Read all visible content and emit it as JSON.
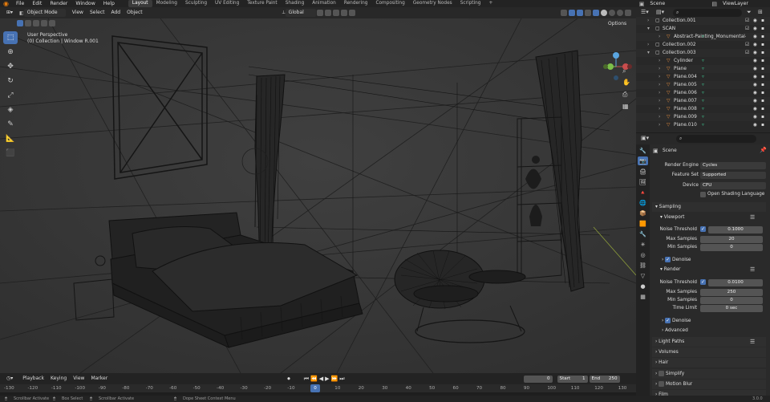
{
  "topbar": {
    "menus": [
      "File",
      "Edit",
      "Render",
      "Window",
      "Help"
    ],
    "workspaces": [
      "Layout",
      "Modeling",
      "Sculpting",
      "UV Editing",
      "Texture Paint",
      "Shading",
      "Animation",
      "Rendering",
      "Compositing",
      "Geometry Nodes",
      "Scripting"
    ],
    "active_workspace": "Layout",
    "add_tab": "+",
    "scene": "Scene",
    "view_layer": "ViewLayer"
  },
  "viewport_header": {
    "mode": "Object Mode",
    "menus": [
      "View",
      "Select",
      "Add",
      "Object"
    ],
    "transform": "Global",
    "options": "Options"
  },
  "viewport": {
    "perspective": "User Perspective",
    "collection_info": "(0) Collection | Window R.001"
  },
  "outliner": {
    "items": [
      {
        "label": "Collection.001",
        "indent": 1,
        "type": "collection"
      },
      {
        "label": "SCAN",
        "indent": 1,
        "type": "collection"
      },
      {
        "label": "Abstract-Painting_Monumental-F",
        "indent": 2,
        "type": "mesh"
      },
      {
        "label": "Collection.002",
        "indent": 1,
        "type": "collection"
      },
      {
        "label": "Collection.003",
        "indent": 1,
        "type": "collection"
      },
      {
        "label": "Cylinder",
        "indent": 2,
        "type": "mesh"
      },
      {
        "label": "Plane",
        "indent": 2,
        "type": "mesh"
      },
      {
        "label": "Plane.004",
        "indent": 2,
        "type": "mesh"
      },
      {
        "label": "Plane.005",
        "indent": 2,
        "type": "mesh"
      },
      {
        "label": "Plane.006",
        "indent": 2,
        "type": "mesh"
      },
      {
        "label": "Plane.007",
        "indent": 2,
        "type": "mesh"
      },
      {
        "label": "Plane.008",
        "indent": 2,
        "type": "mesh"
      },
      {
        "label": "Plane.009",
        "indent": 2,
        "type": "mesh"
      },
      {
        "label": "Plane.010",
        "indent": 2,
        "type": "mesh"
      }
    ]
  },
  "properties": {
    "scene_label": "Scene",
    "render_engine_label": "Render Engine",
    "render_engine": "Cycles",
    "feature_set_label": "Feature Set",
    "feature_set": "Supported",
    "device_label": "Device",
    "device": "CPU",
    "osl_label": "Open Shading Language",
    "sampling": "Sampling",
    "viewport": "Viewport",
    "vp_noise_label": "Noise Threshold",
    "vp_noise": "0.1000",
    "vp_max_label": "Max Samples",
    "vp_max": "20",
    "vp_min_label": "Min Samples",
    "vp_min": "0",
    "vp_denoise": "Denoise",
    "render": "Render",
    "r_noise_label": "Noise Threshold",
    "r_noise": "0.0100",
    "r_max_label": "Max Samples",
    "r_max": "250",
    "r_min_label": "Min Samples",
    "r_min": "0",
    "r_time_label": "Time Limit",
    "r_time": "0 sec",
    "r_denoise": "Denoise",
    "advanced": "Advanced",
    "light_paths": "Light Paths",
    "volumes": "Volumes",
    "hair": "Hair",
    "simplify": "Simplify",
    "motion_blur": "Motion Blur",
    "film": "Film"
  },
  "timeline": {
    "menus": [
      "Playback",
      "Keying",
      "View",
      "Marker"
    ],
    "current_frame": "0",
    "start_label": "Start",
    "start": "1",
    "end_label": "End",
    "end": "250",
    "ruler": [
      "-130",
      "-120",
      "-110",
      "-100",
      "-90",
      "-80",
      "-70",
      "-60",
      "-50",
      "-40",
      "-30",
      "-20",
      "-10",
      "0",
      "10",
      "20",
      "30",
      "40",
      "50",
      "60",
      "70",
      "80",
      "90",
      "100",
      "110",
      "120",
      "130"
    ],
    "playhead": "0"
  },
  "statusbar": {
    "items": [
      "Scrollbar Activate",
      "Box Select",
      "Scrollbar Activate",
      "Dope Sheet Context Menu"
    ],
    "version": "3.0.0"
  },
  "colors": {
    "accent": "#4772b3",
    "bg": "#1d1d1d",
    "panel": "#2a2a2a",
    "viewport": "#3a3a3a",
    "mesh_icon": "#e08a3c",
    "data_icon": "#3fbf8c"
  }
}
